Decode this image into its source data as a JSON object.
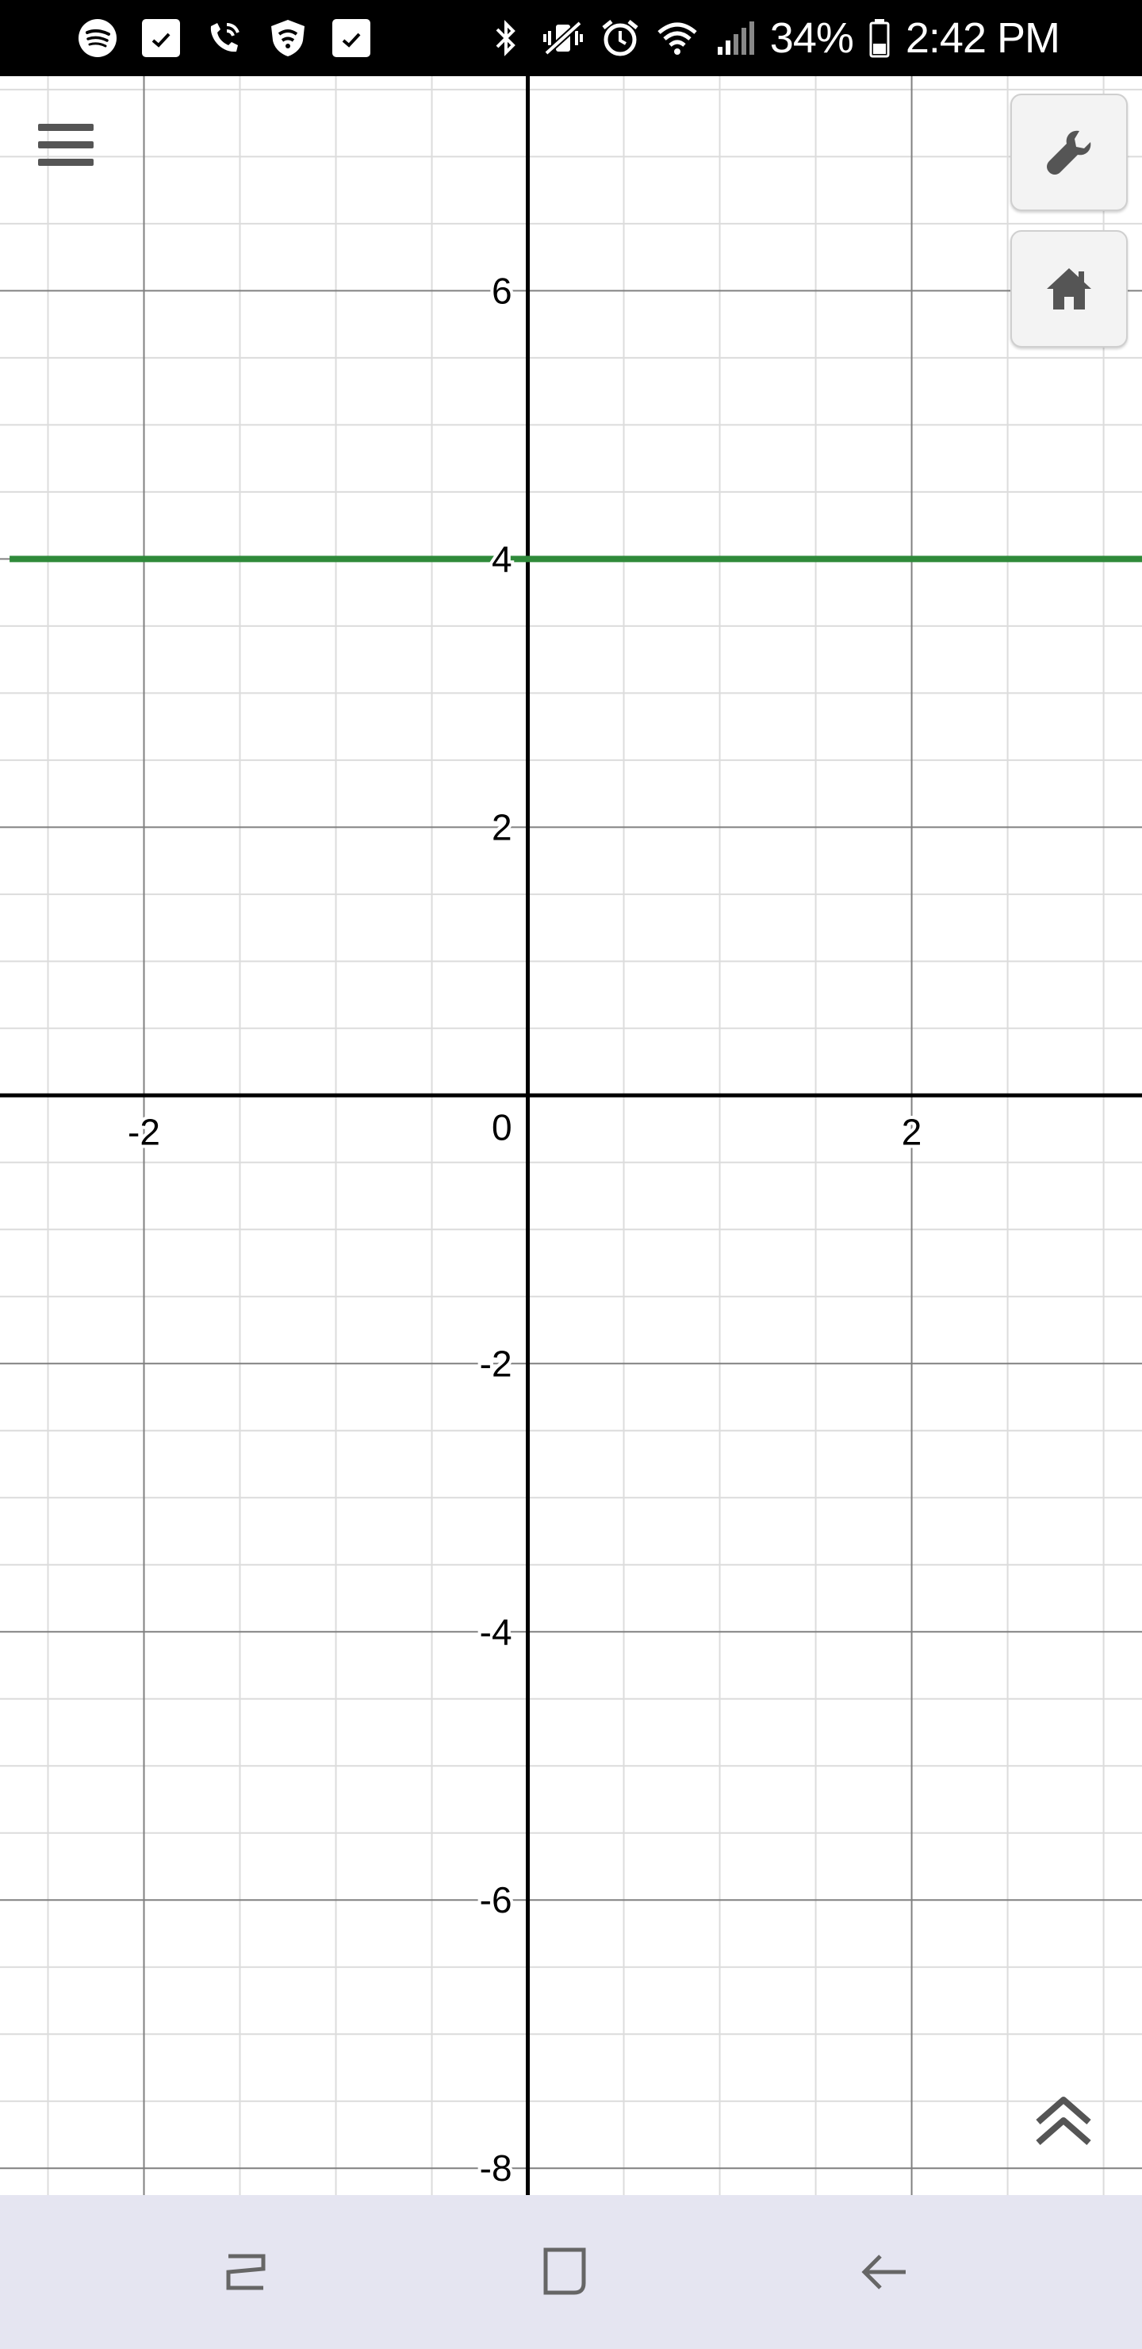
{
  "status_bar": {
    "battery_percent": "34%",
    "time": "2:42 PM",
    "left_icons": [
      "spotify-icon",
      "check-notification-icon",
      "wifi-call-icon",
      "shield-icon",
      "check-notification-icon"
    ],
    "right_icons": [
      "bluetooth-icon",
      "vibrate-mute-icon",
      "alarm-icon",
      "wifi-icon",
      "cell-signal-icon",
      "battery-icon"
    ]
  },
  "graph": {
    "x_tick_labels": [
      "-2",
      "0",
      "2"
    ],
    "y_tick_labels": [
      "6",
      "4",
      "2",
      "-2",
      "-4",
      "-6",
      "-8"
    ],
    "line_color": "#2f8a3a",
    "grid_minor_color": "#dcdcdc",
    "grid_major_color": "#808080",
    "axis_color": "#000000"
  },
  "chart_data": {
    "type": "line",
    "series": [
      {
        "name": "",
        "points": [
          {
            "x": -2.7,
            "y": 4
          },
          {
            "x": 3.2,
            "y": 4
          }
        ]
      }
    ],
    "xlim": [
      -2.75,
      3.2
    ],
    "ylim": [
      -8.2,
      7.6
    ],
    "grid": true,
    "x_ticks": [
      -2,
      0,
      2
    ],
    "y_ticks": [
      -8,
      -6,
      -4,
      -2,
      2,
      4,
      6
    ]
  },
  "toolbar": {
    "menu_icon": "hamburger-menu-icon",
    "settings_icon": "wrench-icon",
    "home_icon": "home-icon",
    "expand_icon": "double-chevron-up-icon"
  },
  "nav_bar": {
    "recent_icon": "recent-apps-icon",
    "home_icon": "home-square-icon",
    "back_icon": "back-arrow-icon"
  }
}
